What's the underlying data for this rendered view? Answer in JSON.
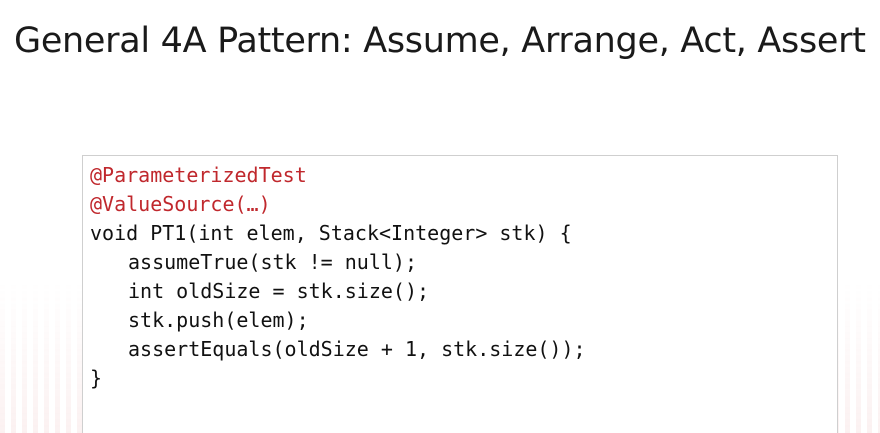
{
  "slide": {
    "title": "General 4A Pattern: Assume, Arrange, Act, Assert"
  },
  "code": {
    "lines": [
      "@ParameterizedTest",
      "@ValueSource(…)",
      "void PT1(int elem, Stack<Integer> stk) {",
      "assumeTrue(stk != null);",
      "int oldSize = stk.size();",
      "stk.push(elem);",
      "assertEquals(oldSize + 1, stk.size());",
      "}"
    ]
  },
  "colors": {
    "annotation": "#c0282d",
    "code_text": "#111111",
    "title_text": "#1a1a1a"
  }
}
